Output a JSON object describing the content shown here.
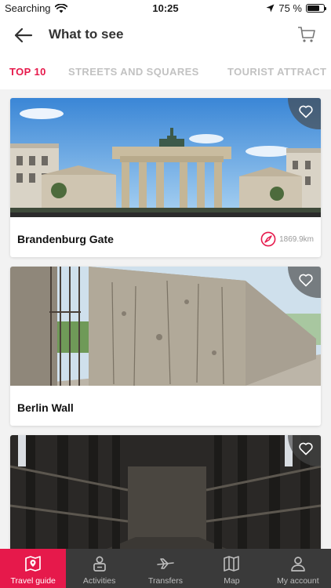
{
  "status_bar": {
    "carrier": "Searching",
    "time": "10:25",
    "battery_percent": 75,
    "battery_label": "75 %"
  },
  "header": {
    "title": "What to see",
    "back_icon": "arrow-left-icon",
    "cart_icon": "cart-icon"
  },
  "tabs": [
    {
      "label": "TOP 10",
      "active": true
    },
    {
      "label": "STREETS AND SQUARES",
      "active": false
    },
    {
      "label": "TOURIST ATTRACT",
      "active": false
    }
  ],
  "cards": [
    {
      "title": "Brandenburg Gate",
      "distance": "1869.9km",
      "image": "brandenburg-gate-photo",
      "favorite": false
    },
    {
      "title": "Berlin Wall",
      "image": "berlin-wall-photo",
      "favorite": false
    },
    {
      "title": "",
      "image": "wooden-structure-photo",
      "favorite": false
    }
  ],
  "bottom_nav": [
    {
      "label": "Travel guide",
      "icon": "map-book-icon",
      "active": true
    },
    {
      "label": "Activities",
      "icon": "person-badge-icon",
      "active": false
    },
    {
      "label": "Transfers",
      "icon": "plane-icon",
      "active": false
    },
    {
      "label": "Map",
      "icon": "map-icon",
      "active": false
    },
    {
      "label": "My account",
      "icon": "user-icon",
      "active": false
    }
  ],
  "colors": {
    "accent": "#e6194b",
    "nav_bg": "#3a3a3a",
    "tab_inactive": "#c2c2c2"
  }
}
